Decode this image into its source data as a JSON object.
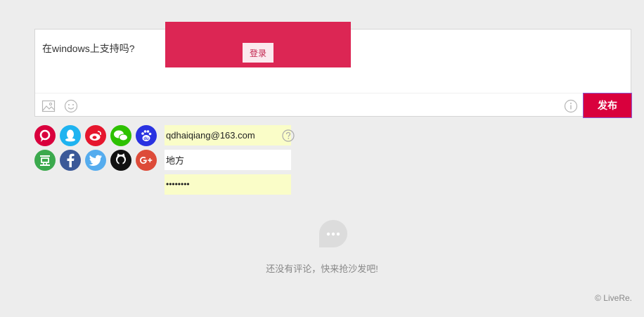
{
  "editor": {
    "comment_text": "在windows上支持吗?",
    "publish_label": "发布"
  },
  "login": {
    "button_label": "登录"
  },
  "social_logins": [
    {
      "name": "livere",
      "color": "#d9003d"
    },
    {
      "name": "qq",
      "color": "#1eb3f0"
    },
    {
      "name": "weibo",
      "color": "#e6162d"
    },
    {
      "name": "wechat",
      "color": "#2dc100"
    },
    {
      "name": "baidu",
      "color": "#2932e1"
    },
    {
      "name": "douban",
      "color": "#3ba94d"
    },
    {
      "name": "facebook",
      "color": "#3b5998"
    },
    {
      "name": "twitter",
      "color": "#55acee"
    },
    {
      "name": "github",
      "color": "#111111"
    },
    {
      "name": "google-plus",
      "color": "#dd4b39"
    }
  ],
  "form": {
    "email": "qdhaiqiang@163.com",
    "name": "地方",
    "password": "••••••••"
  },
  "empty_state": {
    "message": "还没有评论，快来抢沙发吧!"
  },
  "brand": "© LiveRe."
}
